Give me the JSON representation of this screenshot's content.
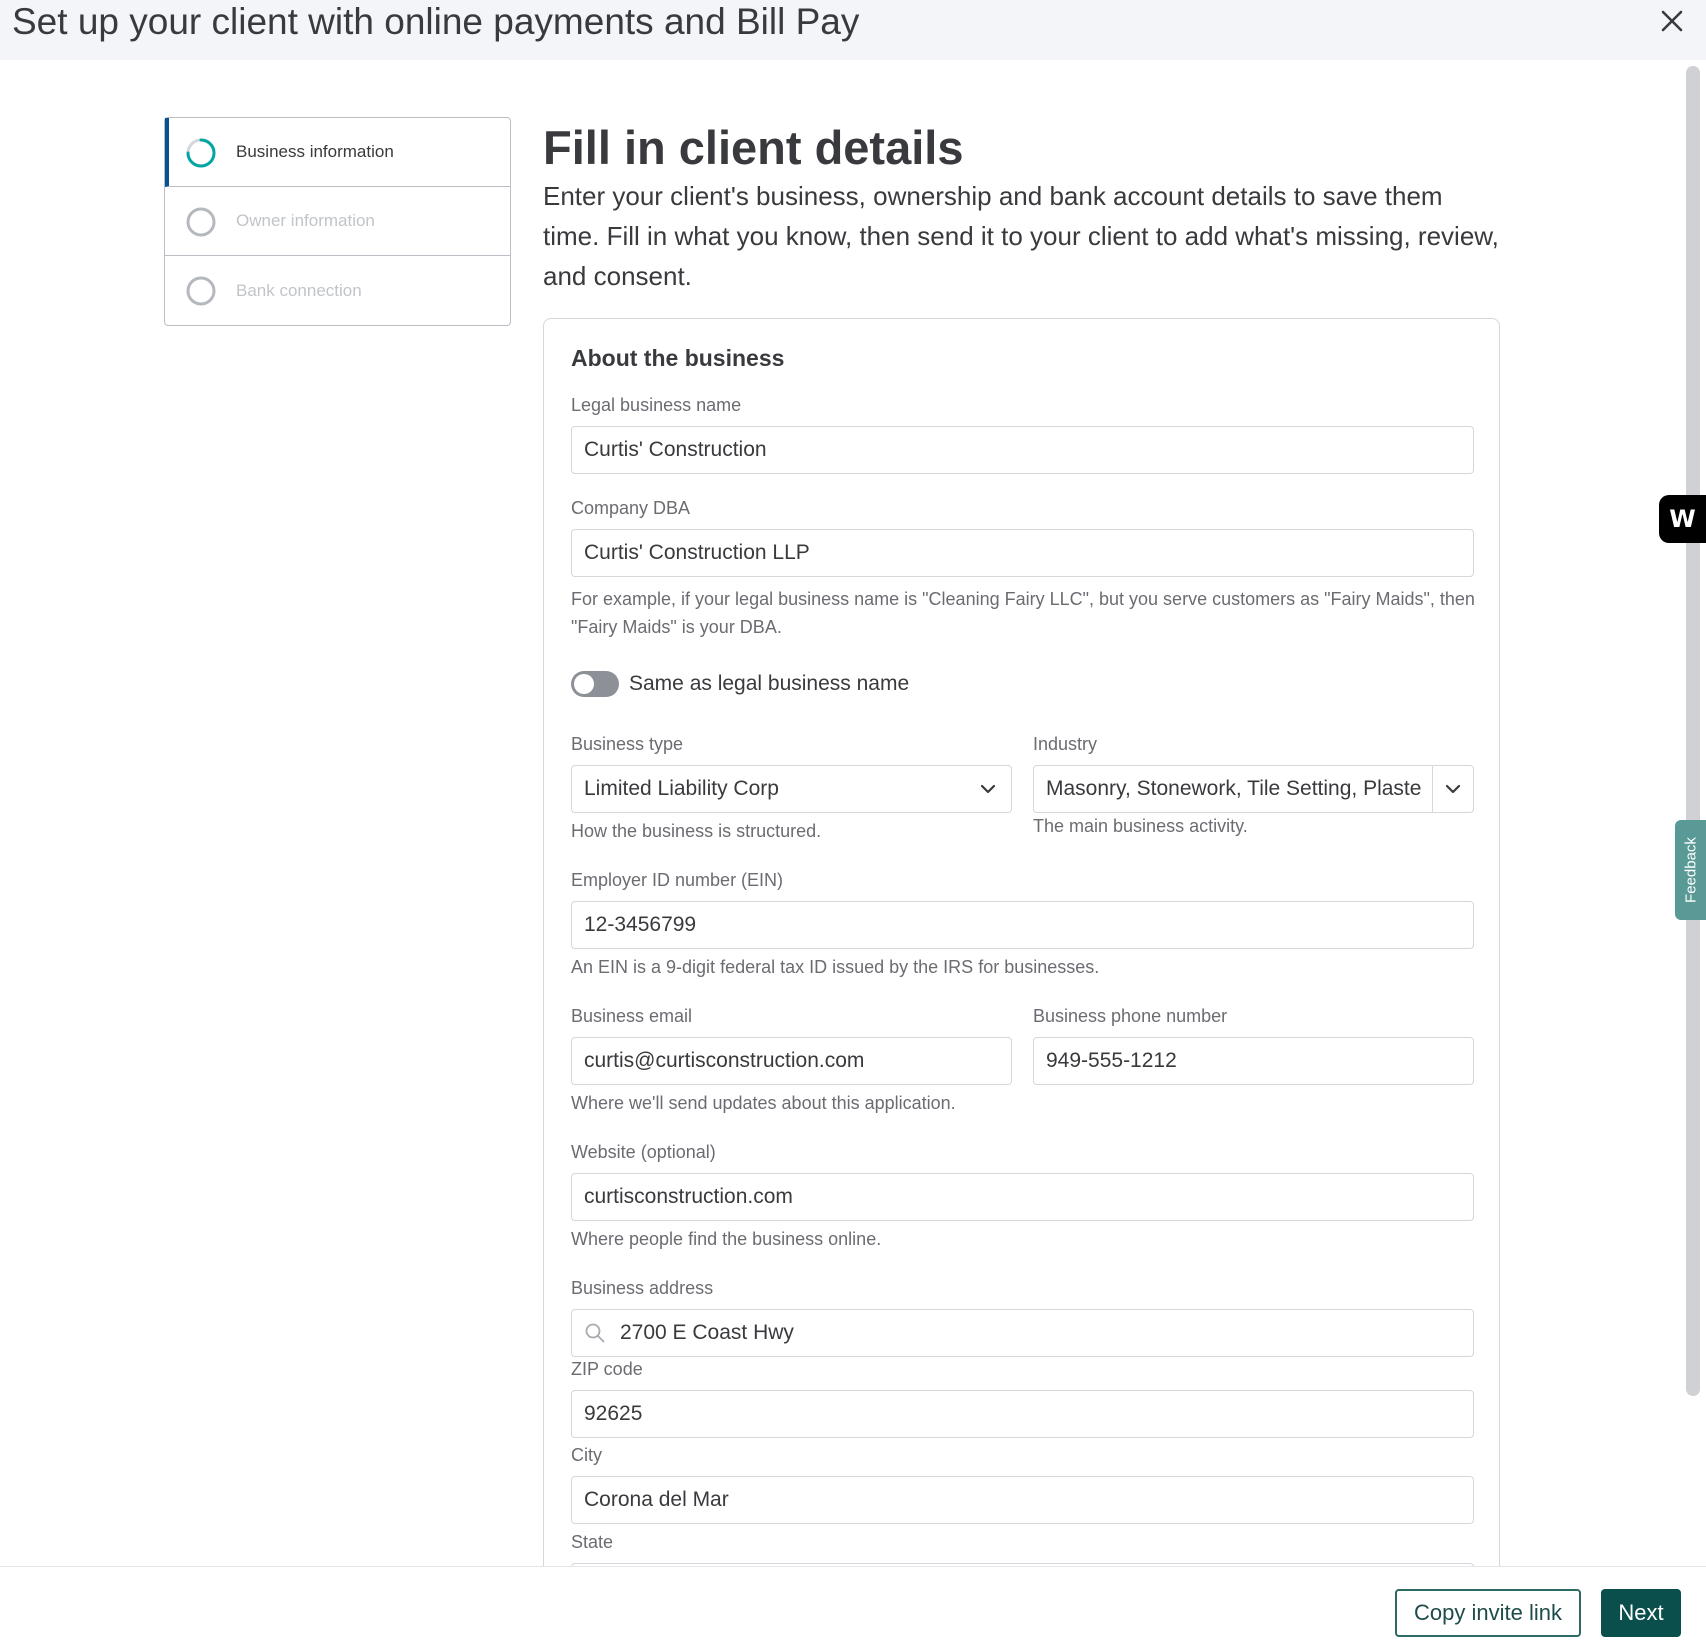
{
  "header": {
    "title": "Set up your client with online payments and Bill Pay",
    "close_icon": "close-icon"
  },
  "stepper": {
    "steps": [
      {
        "label": "Business information",
        "state": "active"
      },
      {
        "label": "Owner information",
        "state": "inactive"
      },
      {
        "label": "Bank connection",
        "state": "inactive"
      }
    ]
  },
  "main": {
    "title": "Fill in client details",
    "description": "Enter your client's business, ownership and bank account details to save them time. Fill in what you know, then send it to your client to add what's missing, review, and consent."
  },
  "form": {
    "section_title": "About the business",
    "legal_name": {
      "label": "Legal business name",
      "value": "Curtis' Construction"
    },
    "dba": {
      "label": "Company DBA",
      "value": "Curtis' Construction LLP",
      "help": "For example, if your legal business name is \"Cleaning Fairy LLC\", but you serve customers as \"Fairy Maids\", then \"Fairy Maids\" is your DBA."
    },
    "same_as_toggle": {
      "label": "Same as legal business name",
      "on": false
    },
    "business_type": {
      "label": "Business type",
      "value": "Limited Liability Corp",
      "help": "How the business is structured."
    },
    "industry": {
      "label": "Industry",
      "value": "Masonry, Stonework, Tile Setting, Plaste",
      "help": "The main business activity."
    },
    "ein": {
      "label": "Employer ID number (EIN)",
      "value": "12-3456799",
      "help": "An EIN is a 9-digit federal tax ID issued by the IRS for businesses."
    },
    "email": {
      "label": "Business email",
      "value": "curtis@curtisconstruction.com",
      "help": "Where we'll send updates about this application."
    },
    "phone": {
      "label": "Business phone number",
      "value": "949-555-1212"
    },
    "website": {
      "label": "Website (optional)",
      "value": "curtisconstruction.com",
      "help": "Where people find the business online."
    },
    "address": {
      "label": "Business address",
      "value": "2700 E Coast Hwy"
    },
    "zip": {
      "label": "ZIP code",
      "value": "92625"
    },
    "city": {
      "label": "City",
      "value": "Corona del Mar"
    },
    "state": {
      "label": "State",
      "value": ""
    }
  },
  "side": {
    "w_badge": "W",
    "feedback": "Feedback"
  },
  "footer": {
    "copy_invite": "Copy invite link",
    "next": "Next"
  },
  "colors": {
    "accent": "#0b4f4d",
    "active_step": "#055393",
    "progress": "#00a6a4",
    "feedback_tab": "#5a9a96"
  }
}
